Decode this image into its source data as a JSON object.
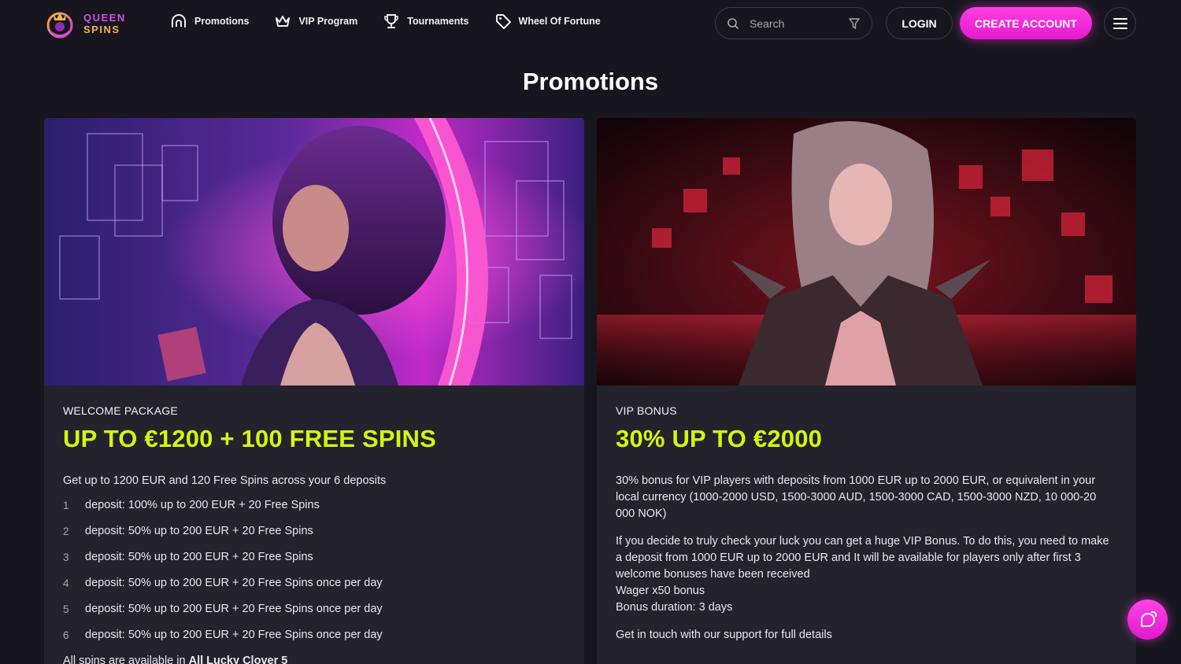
{
  "brand": {
    "line1": "QUEEN",
    "line2": "SPINS",
    "colors": {
      "line1": "#d84ce8",
      "line2": "#f2b648"
    }
  },
  "nav": [
    {
      "label": "Promotions",
      "icon": "arch-icon"
    },
    {
      "label": "VIP Program",
      "icon": "crown-icon"
    },
    {
      "label": "Tournaments",
      "icon": "trophy-icon"
    },
    {
      "label": "Wheel Of Fortune",
      "icon": "tag-icon"
    }
  ],
  "search": {
    "placeholder": "Search",
    "icon": "search-icon",
    "filter_icon": "filter-icon"
  },
  "auth": {
    "login_label": "LOGIN",
    "create_label": "CREATE ACCOUNT"
  },
  "menu": {
    "icon": "hamburger-icon"
  },
  "page": {
    "title": "Promotions"
  },
  "colors": {
    "accent": "#ff3fe0",
    "headline": "#d5f50e",
    "background": "#17161f",
    "card": "#23222d"
  },
  "promos": {
    "welcome": {
      "label": "WELCOME PACKAGE",
      "headline": "UP TO €1200 + 100 FREE SPINS",
      "intro": "Get up to 1200 EUR and 120 Free Spins across your 6 deposits",
      "deposits": [
        {
          "num": "1",
          "text": "deposit: 100% up to 200 EUR + 20 Free Spins"
        },
        {
          "num": "2",
          "text": "deposit: 50% up to 200 EUR + 20 Free Spins"
        },
        {
          "num": "3",
          "text": "deposit: 50% up to 200 EUR + 20 Free Spins"
        },
        {
          "num": "4",
          "text": "deposit: 50% up to 200 EUR + 20 Free Spins once per day"
        },
        {
          "num": "5",
          "text": "deposit: 50% up to 200 EUR + 20 Free Spins once per day"
        },
        {
          "num": "6",
          "text": "deposit: 50% up to 200 EUR + 20 Free Spins once per day"
        }
      ],
      "footnote_start": "All spins are available in ",
      "footnote_bold": "All Lucky Clover 5"
    },
    "vip": {
      "label": "VIP BONUS",
      "headline": "30% UP TO €2000",
      "para1": "30% bonus for VIP players with deposits from 1000 EUR up to 2000 EUR, or equivalent in your local currency (1000-2000 USD, 1500-3000 AUD, 1500-3000 CAD, 1500-3000 NZD, 10 000-20 000 NOK)",
      "para2": "If you decide to truly check your luck you can get a huge VIP Bonus. To do this, you need to make a deposit from 1000 EUR up to 2000 EUR and It will be available for players only after first 3 welcome bonuses have been received",
      "wager": "Wager x50 bonus",
      "duration": "Bonus duration: 3 days",
      "contact": "Get in touch with our support for full details"
    }
  },
  "chat": {
    "icon": "chat-icon"
  }
}
